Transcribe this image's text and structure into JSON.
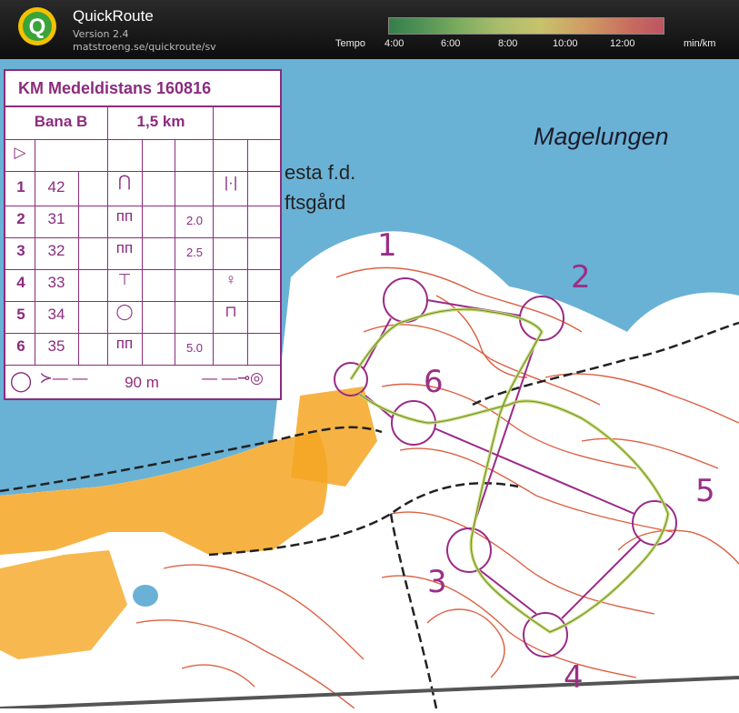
{
  "header": {
    "app_name": "QuickRoute",
    "version": "Version 2.4",
    "url": "matstroeng.se/quickroute/sv",
    "legend_title": "Tempo",
    "legend_ticks": [
      "4:00",
      "6:00",
      "8:00",
      "10:00",
      "12:00"
    ],
    "legend_unit": "min/km",
    "logo_letter": "Q"
  },
  "map": {
    "lake_name": "Magelungen",
    "place_text_1": "esta f.d.",
    "place_text_2": "ftsgård",
    "control_numbers": [
      "1",
      "2",
      "3",
      "4",
      "5",
      "6"
    ],
    "colors": {
      "water": "#6ab1d6",
      "forest": "#ffffff",
      "open_land": "#f5a623",
      "contours": "#d8502f",
      "course": "#9b2a86",
      "route": "#c8d96a"
    }
  },
  "card": {
    "title": "KM Medeldistans 160816",
    "course": "Bana B",
    "length": "1,5 km",
    "rows": [
      {
        "no": "1",
        "code": "42",
        "extra": ""
      },
      {
        "no": "2",
        "code": "31",
        "extra": "2.0"
      },
      {
        "no": "3",
        "code": "32",
        "extra": "2.5"
      },
      {
        "no": "4",
        "code": "33",
        "extra": ""
      },
      {
        "no": "5",
        "code": "34",
        "extra": ""
      },
      {
        "no": "6",
        "code": "35",
        "extra": "5.0"
      }
    ],
    "finish_distance": "90 m"
  }
}
